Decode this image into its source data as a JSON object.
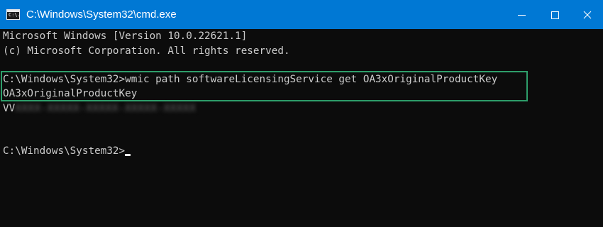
{
  "window": {
    "title": "C:\\Windows\\System32\\cmd.exe",
    "accent_color": "#0078d4",
    "icon_glyph": "C:\\."
  },
  "controls": {
    "minimize": "minimize-icon",
    "maximize": "maximize-icon",
    "close": "close-icon"
  },
  "console": {
    "lines": [
      "Microsoft Windows [Version 10.0.22621.1]",
      "(c) Microsoft Corporation. All rights reserved.",
      "C:\\Windows\\System32>wmic path softwareLicensingService get OA3xOriginalProductKey",
      "OA3xOriginalProductKey",
      "VV",
      "C:\\Windows\\System32>"
    ],
    "redacted_key": "XXXX-XXXXX-XXXXX-XXXXX-XXXXX",
    "highlight_color": "#2e9e6a",
    "text_color": "#cccccc",
    "background_color": "#0c0c0c"
  }
}
